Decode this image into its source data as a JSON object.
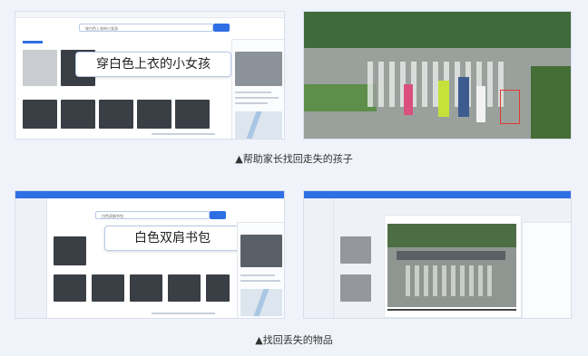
{
  "bubbles": {
    "top": "穿白色上衣的小女孩",
    "bottom": "白色双肩书包"
  },
  "captions": {
    "top": "▲帮助家长找回走失的孩子",
    "bottom": "▲找回丢失的物品"
  },
  "search": {
    "top_query": "穿白色上衣的小女孩",
    "bottom_query": "白色双肩书包"
  },
  "colors": {
    "accent": "#2f6fe4",
    "highlight_box": "#e03a2f"
  }
}
